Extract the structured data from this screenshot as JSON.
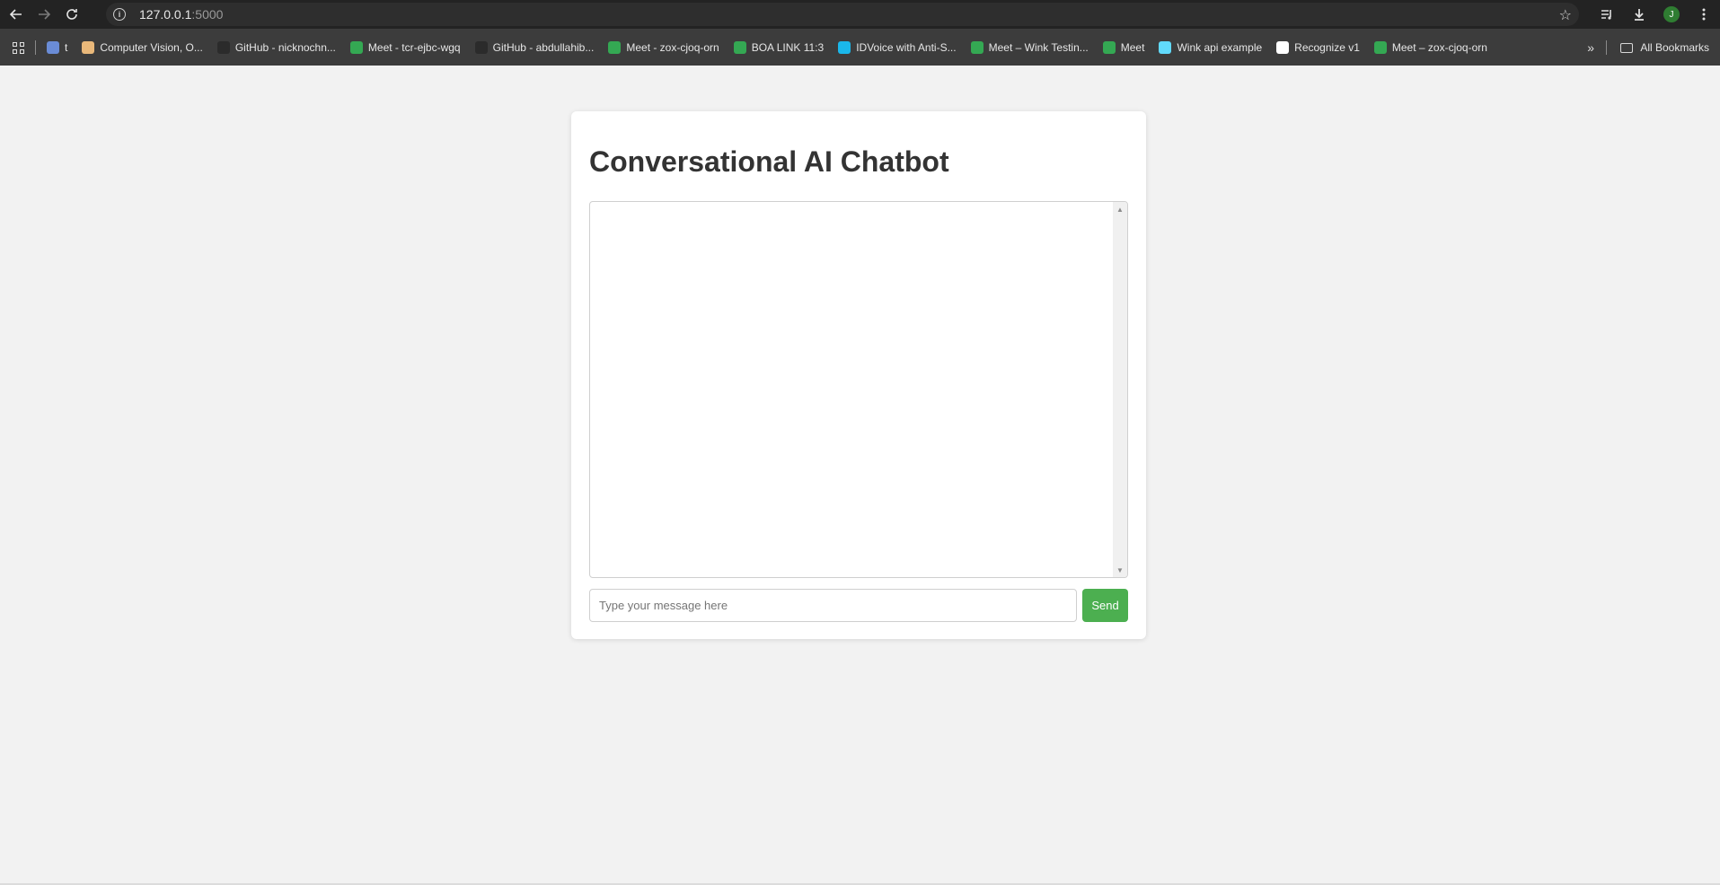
{
  "browser": {
    "url_host": "127.0.0.1",
    "url_port": ":5000",
    "avatar_initial": "J",
    "bookmarks": [
      {
        "label": "t",
        "color": "#6a8cd6"
      },
      {
        "label": "Computer Vision, O...",
        "color": "#e9b87a"
      },
      {
        "label": "GitHub - nicknochn...",
        "color": "#2b2b2b"
      },
      {
        "label": "Meet - tcr-ejbc-wgq",
        "color": "#34a853"
      },
      {
        "label": "GitHub - abdullahib...",
        "color": "#2b2b2b"
      },
      {
        "label": "Meet - zox-cjoq-orn",
        "color": "#34a853"
      },
      {
        "label": "BOA LINK 11:3",
        "color": "#34a853"
      },
      {
        "label": "IDVoice with Anti-S...",
        "color": "#1ab7ea"
      },
      {
        "label": "Meet – Wink Testin...",
        "color": "#34a853"
      },
      {
        "label": "Meet",
        "color": "#34a853"
      },
      {
        "label": "Wink api example",
        "color": "#61dafb"
      },
      {
        "label": "Recognize v1",
        "color": "#ffffff"
      },
      {
        "label": "Meet – zox-cjoq-orn",
        "color": "#34a853"
      }
    ],
    "overflow_label": "»",
    "all_bookmarks_label": "All Bookmarks"
  },
  "page": {
    "title": "Conversational AI Chatbot",
    "input_placeholder": "Type your message here",
    "input_value": "",
    "send_label": "Send",
    "send_color": "#4caf50"
  }
}
